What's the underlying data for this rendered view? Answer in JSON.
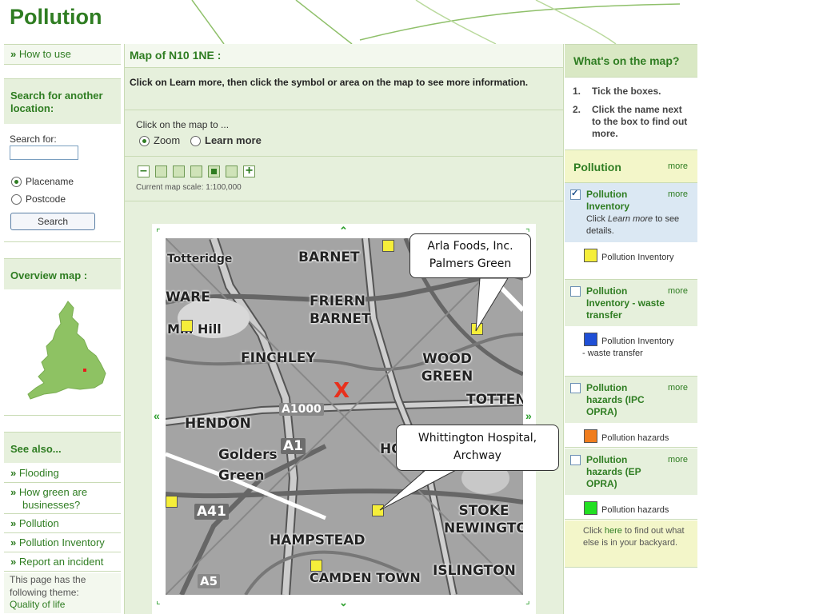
{
  "site": {
    "title": "Pollution"
  },
  "left": {
    "how_to_use": "How to use",
    "search_heading": "Search for another location:",
    "search_label": "Search for:",
    "search_value": "",
    "radio_placename": "Placename",
    "radio_postcode": "Postcode",
    "search_button": "Search",
    "overview_heading": "Overview map :",
    "see_also_heading": "See also...",
    "see_also": [
      "Flooding",
      "How green are businesses?",
      "Pollution",
      "Pollution Inventory",
      "Report an incident"
    ],
    "theme_text": "This page has the following theme:",
    "theme_link": "Quality of life"
  },
  "center": {
    "title": "Map of N10 1NE :",
    "instructions": "Click on Learn more, then click the symbol or area on the map to see more information.",
    "click_label": "Click on the map to ...",
    "opt_zoom": "Zoom",
    "opt_learn": "Learn more",
    "scale_text": "Current map scale: 1:100,000",
    "zoom_level": 5,
    "zoom_levels": 6
  },
  "map": {
    "places": [
      "Totteridge",
      "BARNET",
      "WARE",
      "FRIERN BARNET",
      "Mill Hill",
      "FINCHLEY",
      "WOOD GREEN",
      "TOTTENHAM",
      "HENDON",
      "Golders Green",
      "HAMPSTEAD",
      "STOKE NEWINGTON",
      "CAMDEN TOWN",
      "ISLINGTON",
      "HORNSEY"
    ],
    "roads": [
      "A1000",
      "A1",
      "A41",
      "A5"
    ],
    "marker": "X",
    "callout1": "Arla Foods, Inc. Palmers Green",
    "callout2": "Whittington Hospital, Archway",
    "colors": {
      "pollution_inventory": "#f5ee3a",
      "waste_transfer": "#1f4fd6",
      "ipc_opra": "#f07d1e",
      "ep_opra": "#22e022",
      "marker": "#e8301c"
    }
  },
  "right": {
    "whats_on": "What's on the map?",
    "steps": [
      "Tick the boxes.",
      "Click the name next to the box to find out more."
    ],
    "pollution_heading": "Pollution",
    "more": "more",
    "layer1": "Pollution Inventory",
    "layer1_help_pre": "Click ",
    "layer1_help_em": "Learn more",
    "layer1_help_post": " to see details.",
    "legend1": "Pollution Inventory",
    "layer2": "Pollution Inventory - waste transfer",
    "legend2": "Pollution Inventory - waste transfer",
    "layer3": "Pollution hazards (IPC OPRA)",
    "legend3": "Pollution hazards",
    "layer4": "Pollution hazards (EP OPRA)",
    "legend4": "Pollution hazards",
    "footer_pre": "Click ",
    "footer_link": "here",
    "footer_post": " to find out what else is in your backyard."
  }
}
